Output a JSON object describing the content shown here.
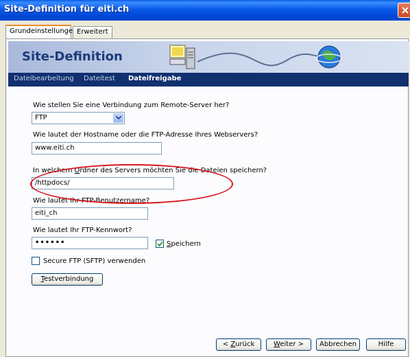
{
  "window": {
    "title": "Site-Definition für eiti.ch"
  },
  "tabs": [
    {
      "label": "Grundeinstellungen"
    },
    {
      "label": "Erweitert"
    }
  ],
  "banner": {
    "title": "Site-Definition"
  },
  "nav": [
    {
      "label": "Dateibearbeitung"
    },
    {
      "label": "Dateitest"
    },
    {
      "label": "Dateifreigabe"
    }
  ],
  "form": {
    "connection_label": "Wie stellen Sie eine Verbindung zum Remote-Server her?",
    "connection_value": "FTP",
    "host_label": "Wie lautet der Hostname oder die FTP-Adresse Ihres Webservers?",
    "host_value": "www.eiti.ch",
    "folder_label": "In welchem Ordner des Servers möchten Sie die Dateien speichern?",
    "folder_value": "/httpdocs/",
    "user_label": "Wie lautet Ihr FTP-Benutzername?",
    "user_value": "eiti_ch",
    "password_label": "Wie lautet Ihr FTP-Kennwort?",
    "password_value": "••••••",
    "save_label": "Speichern",
    "save_checked": true,
    "sftp_label": "Secure FTP (SFTP) verwenden",
    "sftp_checked": false,
    "test_button": "Testverbindung"
  },
  "footer": {
    "back": "< Zurück",
    "next": "Weiter >",
    "cancel": "Abbrechen",
    "help": "Hilfe"
  },
  "colors": {
    "titlebar": "#0b5ae8",
    "nav": "#10306f",
    "annotation": "#d8151b"
  },
  "icons": [
    "close-icon",
    "server-icon",
    "globe-icon",
    "chevron-down-icon",
    "checkmark-icon"
  ]
}
